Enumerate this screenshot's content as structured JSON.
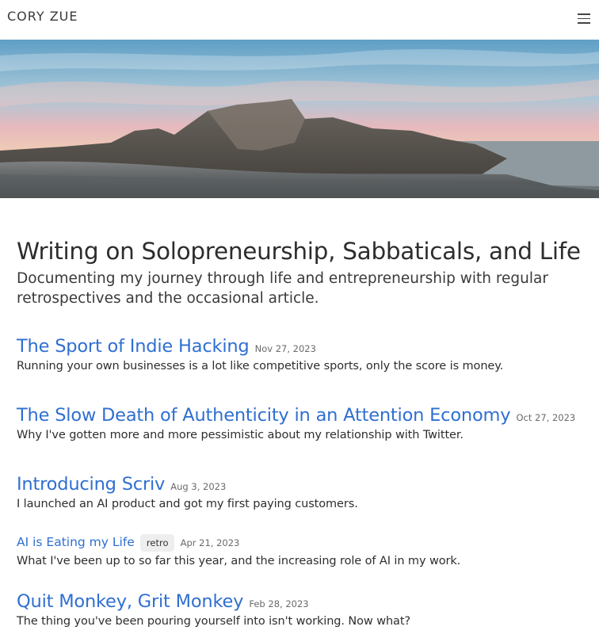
{
  "header": {
    "brand": "CORY ZUE",
    "menu_icon": "hamburger-menu-icon"
  },
  "hero": {
    "image_alt": "Mountain panorama at sunset"
  },
  "main": {
    "title": "Writing on Solopreneurship, Sabbaticals, and Life",
    "subtitle": "Documenting my journey through life and entrepreneurship with regular retrospectives and the occasional article."
  },
  "posts": [
    {
      "title": "The Sport of Indie Hacking",
      "date": "Nov 27, 2023",
      "description": "Running your own businesses is a lot like competitive sports, only the score is money."
    },
    {
      "title": "The Slow Death of Authenticity in an Attention Economy",
      "date": "Oct 27, 2023",
      "description": "Why I've gotten more and more pessimistic about my relationship with Twitter."
    },
    {
      "title": "Introducing Scriv",
      "date": "Aug 3, 2023",
      "description": "I launched an AI product and got my first paying customers."
    },
    {
      "title": "AI is Eating my Life",
      "tag": "retro",
      "date": "Apr 21, 2023",
      "description": "What I've been up to so far this year, and the increasing role of AI in my work."
    },
    {
      "title": "Quit Monkey, Grit Monkey",
      "date": "Feb 28, 2023",
      "description": "The thing you've been pouring yourself into isn't working. Now what?"
    }
  ],
  "colors": {
    "link": "#2f6fd1",
    "text": "#2b2b2b",
    "tag_bg": "#eeeeee"
  }
}
